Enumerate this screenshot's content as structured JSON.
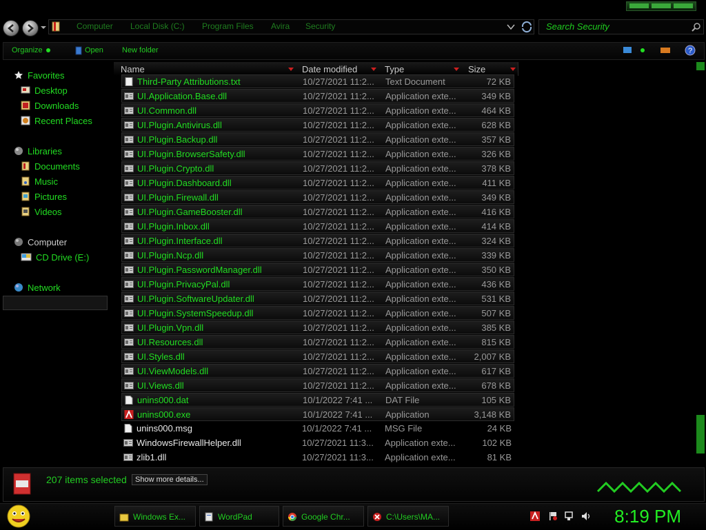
{
  "window": {
    "breadcrumbs": [
      "Computer",
      "Local Disk (C:)",
      "Program Files",
      "Avira",
      "Security"
    ],
    "search_placeholder": "Search Security"
  },
  "toolbar": {
    "organize_label": "Organize",
    "open_label": "Open",
    "new_folder_label": "New folder"
  },
  "navpane": {
    "favorites_label": "Favorites",
    "favorites": [
      "Desktop",
      "Downloads",
      "Recent Places"
    ],
    "libraries_label": "Libraries",
    "libraries": [
      "Documents",
      "Music",
      "Pictures",
      "Videos"
    ],
    "computer_label": "Computer",
    "computer_items": [
      "CD Drive (E:)"
    ],
    "network_label": "Network"
  },
  "columns": {
    "name": "Name",
    "date": "Date modified",
    "type": "Type",
    "size": "Size"
  },
  "files": [
    {
      "name": "Third-Party Attributions.txt",
      "date": "10/27/2021 11:2...",
      "type": "Text Document",
      "size": "72 KB",
      "style": "sel",
      "icon": "text-file-icon"
    },
    {
      "name": "UI.Application.Base.dll",
      "date": "10/27/2021 11:2...",
      "type": "Application exte...",
      "size": "349 KB",
      "style": "sel",
      "icon": "dll-icon"
    },
    {
      "name": "UI.Common.dll",
      "date": "10/27/2021 11:2...",
      "type": "Application exte...",
      "size": "464 KB",
      "style": "sel",
      "icon": "dll-icon"
    },
    {
      "name": "UI.Plugin.Antivirus.dll",
      "date": "10/27/2021 11:2...",
      "type": "Application exte...",
      "size": "628 KB",
      "style": "sel",
      "icon": "dll-icon"
    },
    {
      "name": "UI.Plugin.Backup.dll",
      "date": "10/27/2021 11:2...",
      "type": "Application exte...",
      "size": "357 KB",
      "style": "sel",
      "icon": "dll-icon"
    },
    {
      "name": "UI.Plugin.BrowserSafety.dll",
      "date": "10/27/2021 11:2...",
      "type": "Application exte...",
      "size": "326 KB",
      "style": "sel",
      "icon": "dll-icon"
    },
    {
      "name": "UI.Plugin.Crypto.dll",
      "date": "10/27/2021 11:2...",
      "type": "Application exte...",
      "size": "378 KB",
      "style": "sel",
      "icon": "dll-icon"
    },
    {
      "name": "UI.Plugin.Dashboard.dll",
      "date": "10/27/2021 11:2...",
      "type": "Application exte...",
      "size": "411 KB",
      "style": "sel",
      "icon": "dll-icon"
    },
    {
      "name": "UI.Plugin.Firewall.dll",
      "date": "10/27/2021 11:2...",
      "type": "Application exte...",
      "size": "349 KB",
      "style": "sel",
      "icon": "dll-icon"
    },
    {
      "name": "UI.Plugin.GameBooster.dll",
      "date": "10/27/2021 11:2...",
      "type": "Application exte...",
      "size": "416 KB",
      "style": "sel",
      "icon": "dll-icon"
    },
    {
      "name": "UI.Plugin.Inbox.dll",
      "date": "10/27/2021 11:2...",
      "type": "Application exte...",
      "size": "414 KB",
      "style": "sel",
      "icon": "dll-icon"
    },
    {
      "name": "UI.Plugin.Interface.dll",
      "date": "10/27/2021 11:2...",
      "type": "Application exte...",
      "size": "324 KB",
      "style": "sel",
      "icon": "dll-icon"
    },
    {
      "name": "UI.Plugin.Ncp.dll",
      "date": "10/27/2021 11:2...",
      "type": "Application exte...",
      "size": "339 KB",
      "style": "sel",
      "icon": "dll-icon"
    },
    {
      "name": "UI.Plugin.PasswordManager.dll",
      "date": "10/27/2021 11:2...",
      "type": "Application exte...",
      "size": "350 KB",
      "style": "sel",
      "icon": "dll-icon"
    },
    {
      "name": "UI.Plugin.PrivacyPal.dll",
      "date": "10/27/2021 11:2...",
      "type": "Application exte...",
      "size": "436 KB",
      "style": "sel",
      "icon": "dll-icon"
    },
    {
      "name": "UI.Plugin.SoftwareUpdater.dll",
      "date": "10/27/2021 11:2...",
      "type": "Application exte...",
      "size": "531 KB",
      "style": "sel",
      "icon": "dll-icon"
    },
    {
      "name": "UI.Plugin.SystemSpeedup.dll",
      "date": "10/27/2021 11:2...",
      "type": "Application exte...",
      "size": "507 KB",
      "style": "sel",
      "icon": "dll-icon"
    },
    {
      "name": "UI.Plugin.Vpn.dll",
      "date": "10/27/2021 11:2...",
      "type": "Application exte...",
      "size": "385 KB",
      "style": "sel",
      "icon": "dll-icon"
    },
    {
      "name": "UI.Resources.dll",
      "date": "10/27/2021 11:2...",
      "type": "Application exte...",
      "size": "815 KB",
      "style": "sel",
      "icon": "dll-icon"
    },
    {
      "name": "UI.Styles.dll",
      "date": "10/27/2021 11:2...",
      "type": "Application exte...",
      "size": "2,007 KB",
      "style": "sel",
      "icon": "dll-icon"
    },
    {
      "name": "UI.ViewModels.dll",
      "date": "10/27/2021 11:2...",
      "type": "Application exte...",
      "size": "617 KB",
      "style": "sel",
      "icon": "dll-icon"
    },
    {
      "name": "UI.Views.dll",
      "date": "10/27/2021 11:2...",
      "type": "Application exte...",
      "size": "678 KB",
      "style": "sel",
      "icon": "dll-icon"
    },
    {
      "name": "unins000.dat",
      "date": "10/1/2022 7:41 ...",
      "type": "DAT File",
      "size": "105 KB",
      "style": "sel",
      "icon": "blank-file-icon"
    },
    {
      "name": "unins000.exe",
      "date": "10/1/2022 7:41 ...",
      "type": "Application",
      "size": "3,148 KB",
      "style": "sel",
      "icon": "avira-app-icon"
    },
    {
      "name": "unins000.msg",
      "date": "10/1/2022 7:41 ...",
      "type": "MSG File",
      "size": "24 KB",
      "style": "plain",
      "icon": "blank-file-icon"
    },
    {
      "name": "WindowsFirewallHelper.dll",
      "date": "10/27/2021 11:3...",
      "type": "Application exte...",
      "size": "102 KB",
      "style": "plain",
      "icon": "dll-icon"
    },
    {
      "name": "zlib1.dll",
      "date": "10/27/2021 11:3...",
      "type": "Application exte...",
      "size": "81 KB",
      "style": "plain",
      "icon": "dll-icon"
    }
  ],
  "details": {
    "status": "207 items selected",
    "show_more": "Show more details..."
  },
  "taskbar": {
    "items": [
      "Windows Ex...",
      "WordPad",
      "Google Chr...",
      "C:\\Users\\MA..."
    ],
    "clock": "8:19 PM"
  },
  "colors": {
    "accent": "#22dd22",
    "background": "#000000",
    "sort_arrow": "#cc2020"
  }
}
